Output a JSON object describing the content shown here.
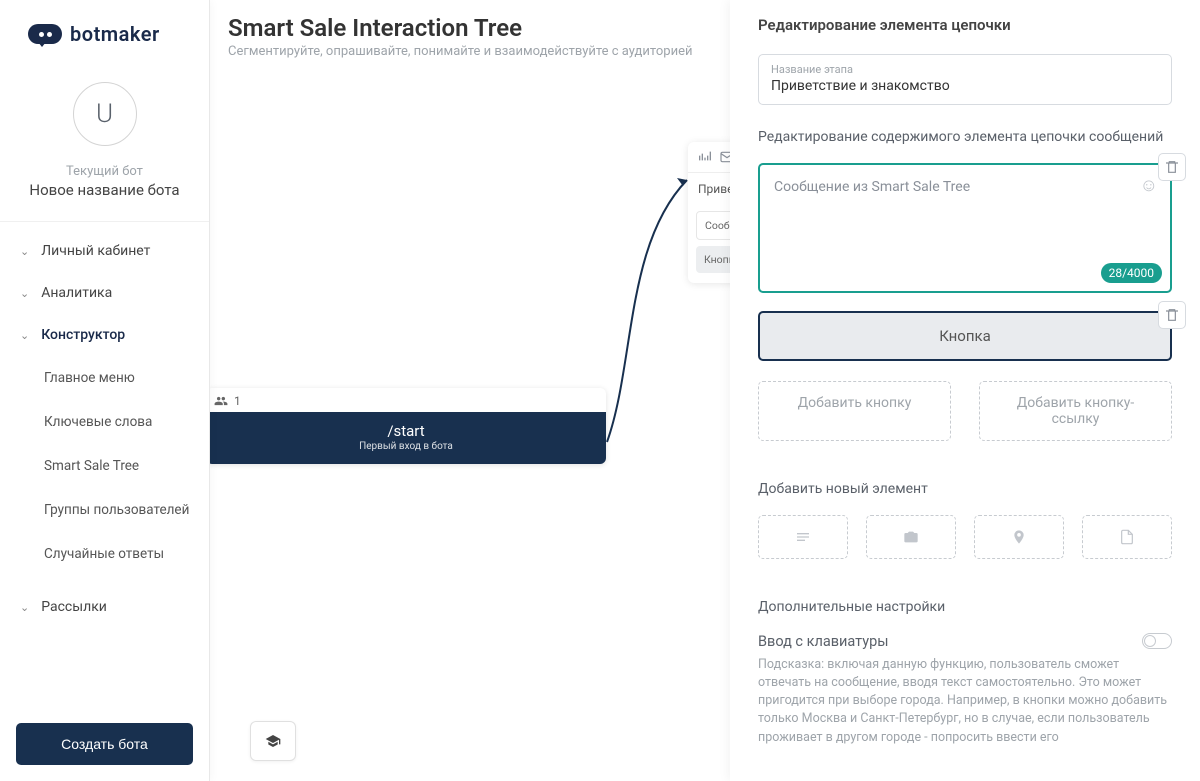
{
  "brand": "botmaker",
  "user": {
    "initial": "U",
    "current_bot_label": "Текущий бот",
    "bot_name": "Новое название бота"
  },
  "nav": {
    "lk": "Личный кабинет",
    "analytics": "Аналитика",
    "constructor": "Конструктор",
    "sub_main_menu": "Главное меню",
    "sub_keywords": "Ключевые слова",
    "sub_sale_tree": "Smart Sale Tree",
    "sub_groups": "Группы пользователей",
    "sub_random": "Случайные ответы",
    "mailings": "Рассылки"
  },
  "create_bot": "Создать бота",
  "canvas": {
    "title": "Smart Sale Interaction Tree",
    "subtitle": "Сегментируйте, опрашивайте, понимайте и взаимодействуйте с аудиторией",
    "start_count": "1",
    "start_cmd": "/start",
    "start_sub": "Первый вход в бота",
    "step_title": "Приветствие и знакомство",
    "step_msg": "Сообщение из Smart Sale Tree",
    "step_btn": "Кнопка"
  },
  "panel": {
    "header": "Редактирование элемента цепочки",
    "stage_label": "Название этапа",
    "stage_value": "Приветствие и знакомство",
    "content_label": "Редактирование содержимого элемента цепочки сообщений",
    "msg_text": "Сообщение из Smart Sale Tree",
    "counter": "28/4000",
    "button_text": "Кнопка",
    "add_button": "Добавить кнопку",
    "add_link_button": "Добавить кнопку-ссылку",
    "add_element_title": "Добавить новый элемент",
    "settings_title": "Дополнительные настройки",
    "kb_input_title": "Ввод с клавиатуры",
    "kb_input_hint": "Подсказка: включая данную функцию, пользователь сможет отвечать на сообщение, вводя текст самостоятельно. Это может пригодится при выборе города. Например, в кнопки можно добавить только Москва и Санкт-Петербург, но в случае, если пользователь проживает в другом городе - попросить ввести его"
  }
}
